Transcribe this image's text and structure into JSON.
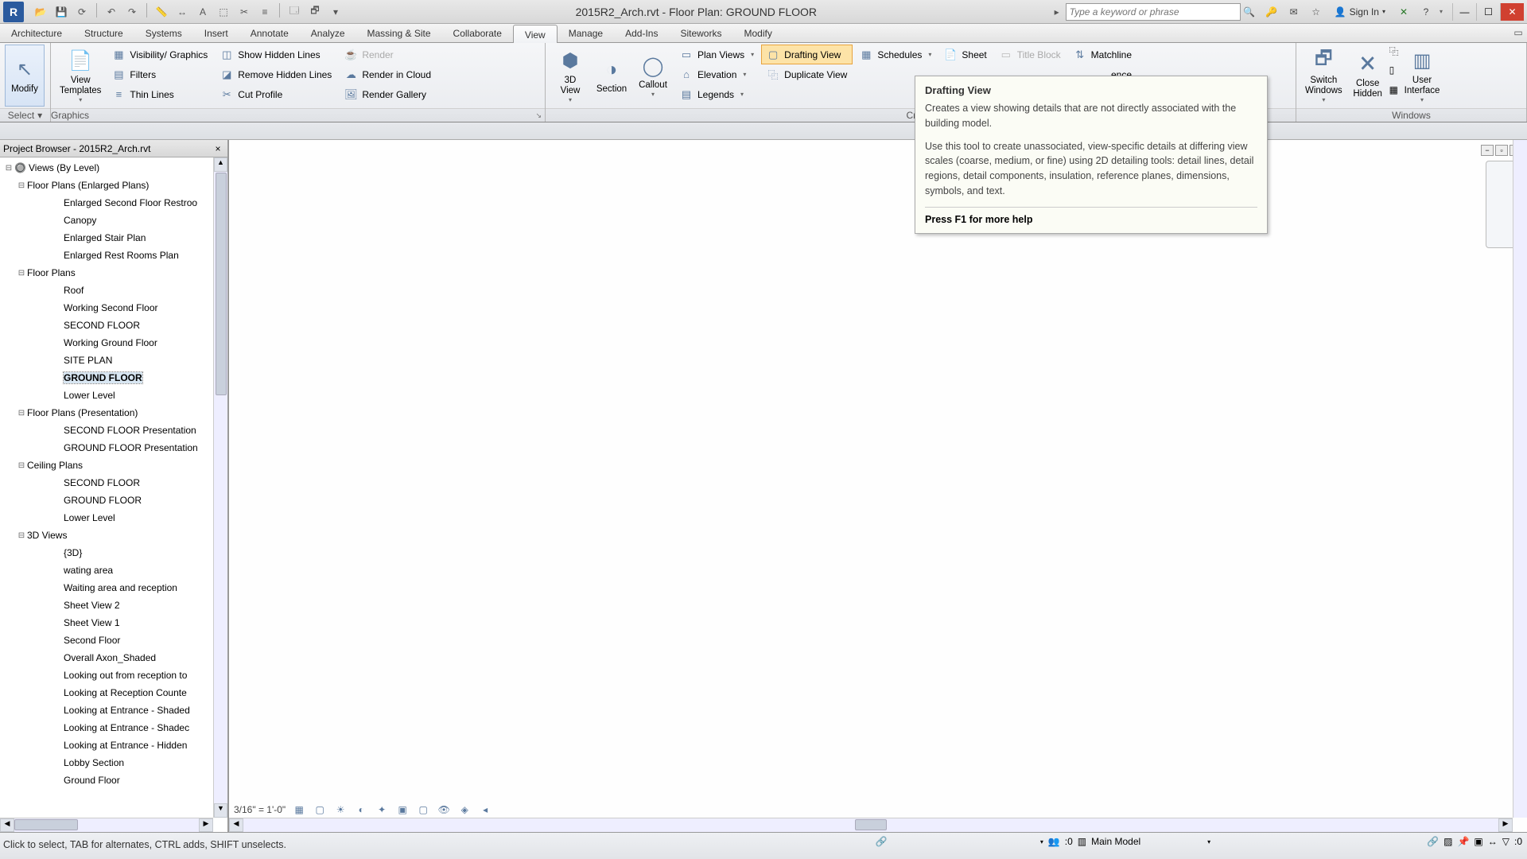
{
  "title": "2015R2_Arch.rvt - Floor Plan: GROUND FLOOR",
  "search_placeholder": "Type a keyword or phrase",
  "signin": "Sign In",
  "menutabs": [
    "Architecture",
    "Structure",
    "Systems",
    "Insert",
    "Annotate",
    "Analyze",
    "Massing & Site",
    "Collaborate",
    "View",
    "Manage",
    "Add-Ins",
    "Siteworks",
    "Modify"
  ],
  "active_tab": "View",
  "ribbon": {
    "select": {
      "modify": "Modify",
      "select": "Select"
    },
    "graphics": {
      "title": "Graphics",
      "view_templates": "View\nTemplates",
      "visibility": "Visibility/ Graphics",
      "filters": "Filters",
      "thin_lines": "Thin  Lines",
      "show_hidden": "Show  Hidden Lines",
      "remove_hidden": "Remove  Hidden Lines",
      "cut_profile": "Cut  Profile",
      "render": "Render",
      "render_cloud": "Render  in Cloud",
      "render_gallery": "Render  Gallery"
    },
    "create": {
      "title": "Create",
      "three_d": "3D\nView",
      "section": "Section",
      "callout": "Callout",
      "plan_views": "Plan  Views",
      "elevation": "Elevation",
      "legends": "Legends",
      "drafting_view": "Drafting  View",
      "duplicate_view": "Duplicate  View",
      "schedules": "Schedules",
      "sheet": "Sheet",
      "title_block": "Title  Block",
      "matchline": "Matchline",
      "reference_suffix": "ence"
    },
    "windows": {
      "title": "Windows",
      "switch": "Switch\nWindows",
      "close_hidden": "Close\nHidden",
      "ui": "User\nInterface"
    }
  },
  "tooltip": {
    "title": "Drafting View",
    "p1": "Creates a view showing details that are not directly associated with the building model.",
    "p2": "Use this tool to create unassociated, view-specific details at differing view scales (coarse, medium, or fine) using 2D detailing tools: detail lines, detail regions, detail components, insulation, reference planes, dimensions, symbols, and text.",
    "help": "Press F1 for more help"
  },
  "project_browser": {
    "title": "Project Browser - 2015R2_Arch.rvt",
    "root": "Views (By Level)",
    "groups": [
      {
        "label": "Floor Plans (Enlarged Plans)",
        "items": [
          "Enlarged Second Floor Restroo",
          "Canopy",
          "Enlarged Stair Plan",
          "Enlarged Rest Rooms Plan"
        ]
      },
      {
        "label": "Floor Plans",
        "items": [
          "Roof",
          "Working Second Floor",
          "SECOND FLOOR",
          "Working Ground Floor",
          "SITE PLAN",
          "GROUND FLOOR",
          "Lower Level"
        ],
        "selected": "GROUND FLOOR"
      },
      {
        "label": "Floor Plans (Presentation)",
        "items": [
          "SECOND FLOOR Presentation",
          "GROUND FLOOR Presentation"
        ]
      },
      {
        "label": "Ceiling Plans",
        "items": [
          "SECOND FLOOR",
          "GROUND FLOOR",
          "Lower Level"
        ]
      },
      {
        "label": "3D Views",
        "items": [
          "{3D}",
          "wating area",
          "Waiting area and reception",
          "Sheet View 2",
          "Sheet View 1",
          "Second Floor",
          "Overall Axon_Shaded",
          "Looking out from reception to",
          "Looking at Reception Counte",
          "Looking at Entrance - Shaded",
          "Looking at Entrance - Shadec",
          "Looking at Entrance - Hidden",
          "Lobby Section",
          "Ground Floor"
        ]
      }
    ]
  },
  "viewbar": {
    "scale": "3/16\" = 1'-0\""
  },
  "status": {
    "hint": "Click to select, TAB for alternates, CTRL adds, SHIFT unselects.",
    "zero": ":0",
    "main_model": "Main Model",
    "filter_zero": ":0"
  }
}
